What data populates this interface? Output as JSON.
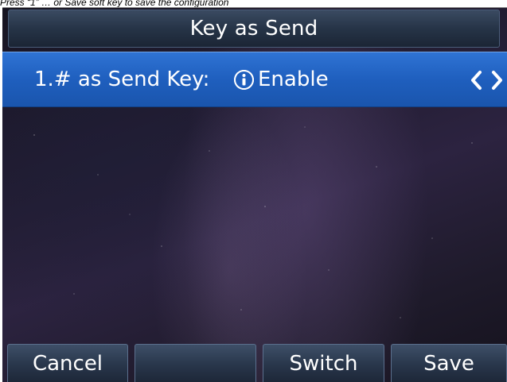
{
  "document": {
    "caption": "Press “1” … or Save soft key to save the configuration"
  },
  "screen": {
    "title": "Key as Send",
    "list": [
      {
        "label": "1.# as Send Key:",
        "value": "Enable",
        "info_icon": "info-icon",
        "prev_icon": "chevron-left-icon",
        "next_icon": "chevron-right-icon"
      }
    ],
    "softkeys": [
      {
        "label": "Cancel"
      },
      {
        "label": ""
      },
      {
        "label": "Switch"
      },
      {
        "label": "Save"
      }
    ]
  },
  "colors": {
    "selection": "#1f5fbe",
    "title_bar": "#263447",
    "softkey": "#2a384d",
    "text": "#ffffff"
  }
}
